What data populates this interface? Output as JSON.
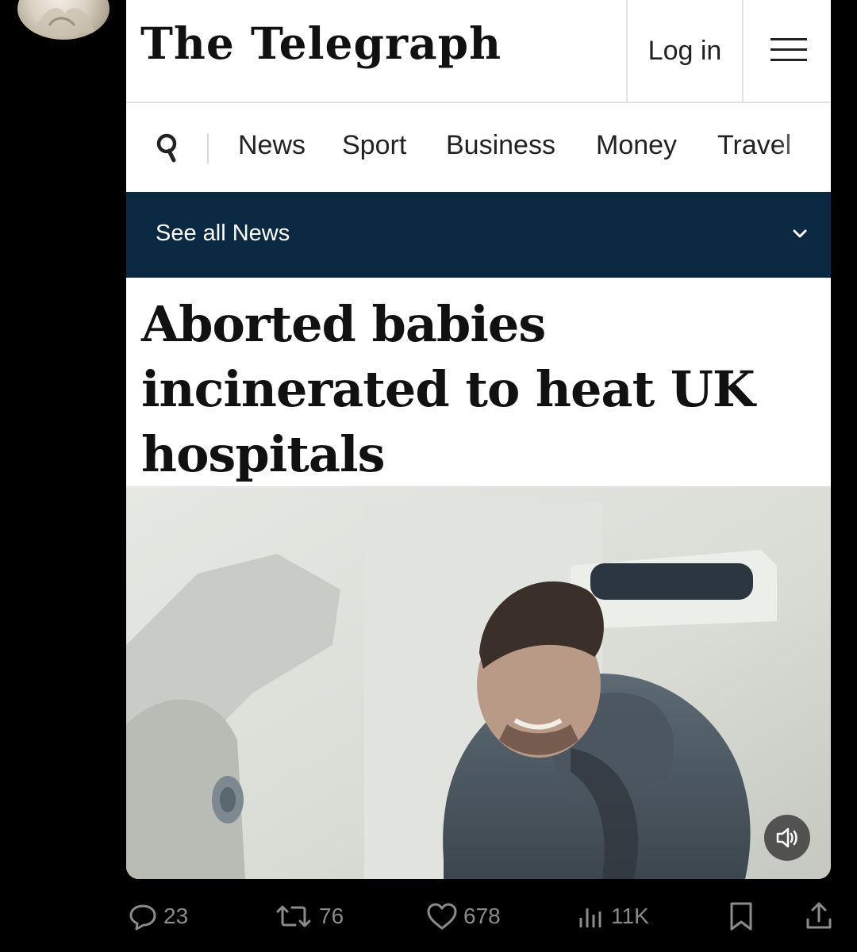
{
  "publication": {
    "logo": "The Telegraph",
    "login_label": "Log in"
  },
  "nav": {
    "items": [
      "News",
      "Sport",
      "Business",
      "Money",
      "Travel"
    ]
  },
  "section_bar": {
    "label": "See all News"
  },
  "article": {
    "headline": "Aborted babies incinerated to heat UK hospitals"
  },
  "post_actions": {
    "replies": "23",
    "reposts": "76",
    "likes": "678",
    "views": "11K"
  },
  "colors": {
    "section_bar": "#0c2944",
    "background": "#000000",
    "action_gray": "#8b8b8b"
  },
  "icons": [
    "menu-icon",
    "search-icon",
    "chevron-down-icon",
    "sound-icon",
    "reply-icon",
    "repost-icon",
    "like-icon",
    "views-icon",
    "bookmark-icon",
    "share-icon"
  ]
}
